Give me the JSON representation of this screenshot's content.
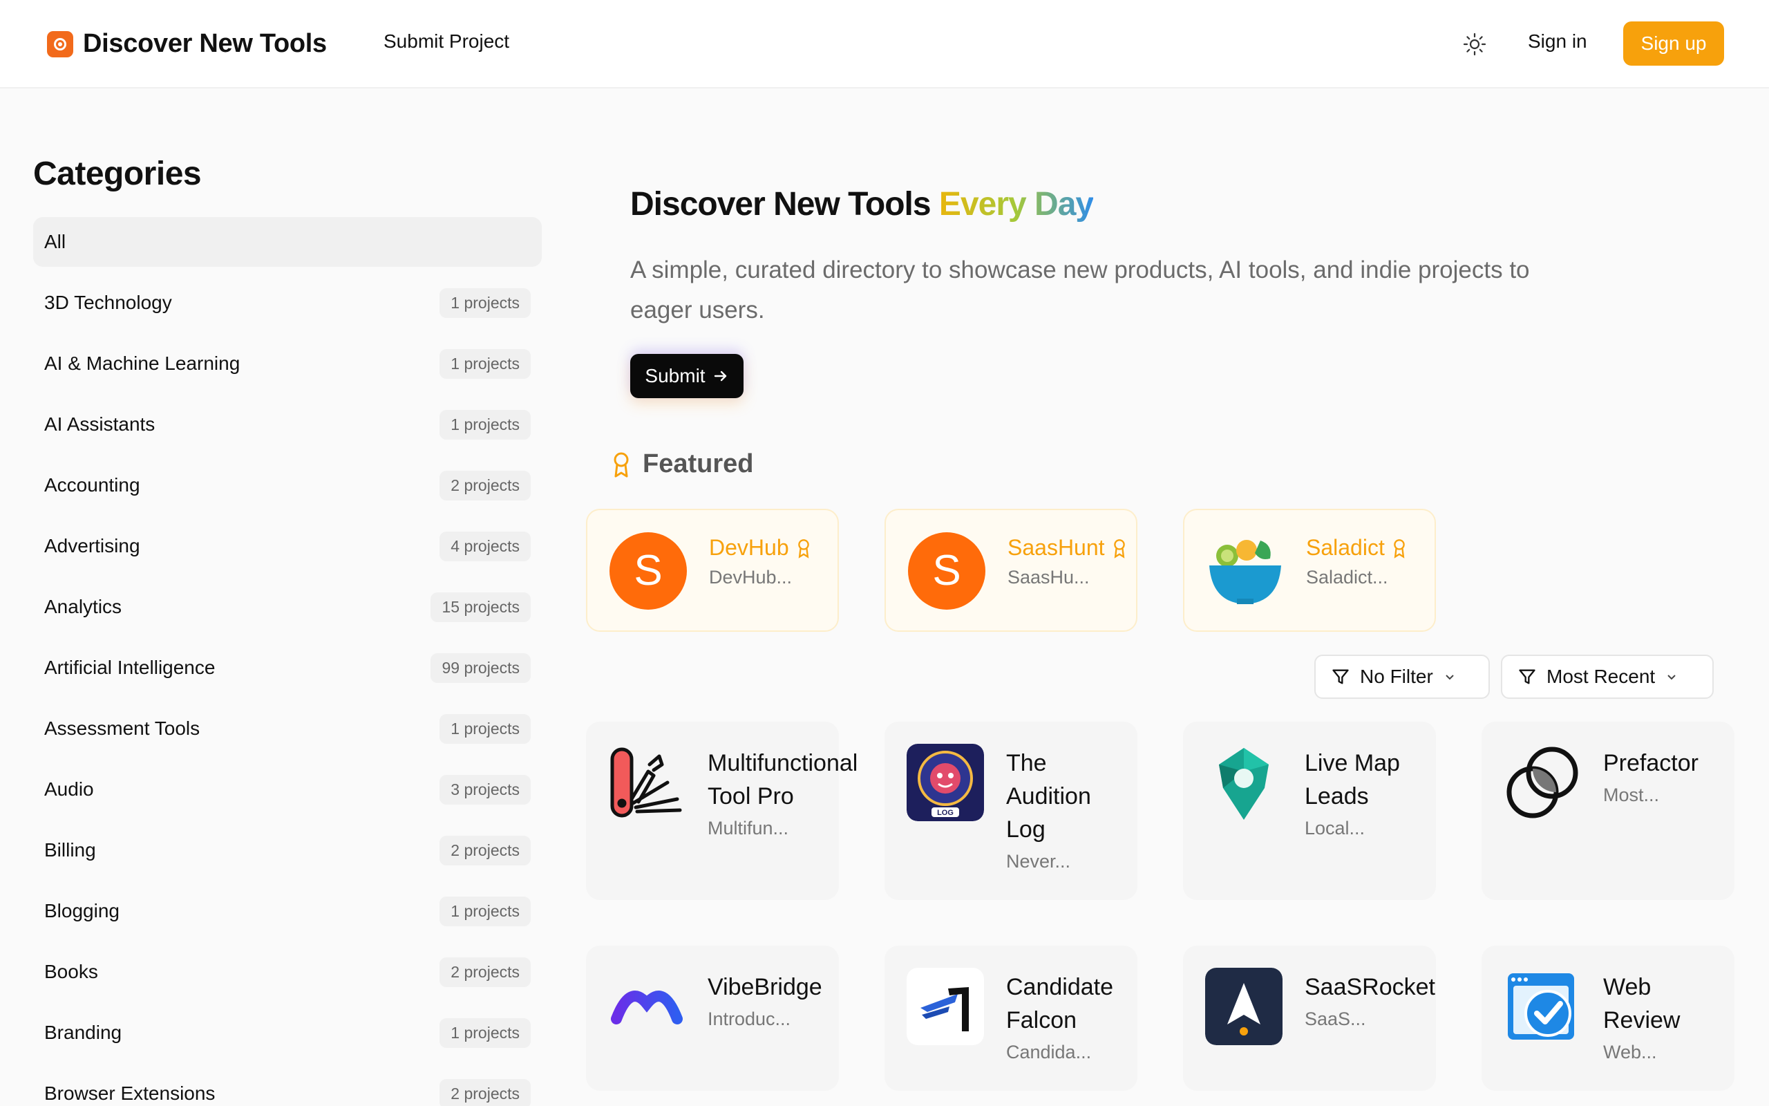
{
  "header": {
    "brand": "Discover New Tools",
    "nav_submit": "Submit Project",
    "sign_in": "Sign in",
    "sign_up": "Sign up"
  },
  "sidebar": {
    "title": "Categories",
    "items": [
      {
        "label": "All",
        "count": ""
      },
      {
        "label": "3D Technology",
        "count": "1 projects"
      },
      {
        "label": "AI & Machine Learning",
        "count": "1 projects"
      },
      {
        "label": "AI Assistants",
        "count": "1 projects"
      },
      {
        "label": "Accounting",
        "count": "2 projects"
      },
      {
        "label": "Advertising",
        "count": "4 projects"
      },
      {
        "label": "Analytics",
        "count": "15 projects"
      },
      {
        "label": "Artificial Intelligence",
        "count": "99 projects"
      },
      {
        "label": "Assessment Tools",
        "count": "1 projects"
      },
      {
        "label": "Audio",
        "count": "3 projects"
      },
      {
        "label": "Billing",
        "count": "2 projects"
      },
      {
        "label": "Blogging",
        "count": "1 projects"
      },
      {
        "label": "Books",
        "count": "2 projects"
      },
      {
        "label": "Branding",
        "count": "1 projects"
      },
      {
        "label": "Browser Extensions",
        "count": "2 projects"
      }
    ]
  },
  "hero": {
    "title_main": "Discover New Tools",
    "title_accent": "Every Day",
    "subtitle": "A simple, curated directory to showcase new products, AI tools, and indie projects to eager users.",
    "submit_label": "Submit"
  },
  "featured": {
    "label": "Featured",
    "items": [
      {
        "name": "DevHub",
        "desc": "DevHub...",
        "icon": "s-orange-logo"
      },
      {
        "name": "SaasHunt",
        "desc": "SaasHu...",
        "icon": "s-orange-logo"
      },
      {
        "name": "Saladict",
        "desc": "Saladict...",
        "icon": "salad-bowl-logo"
      }
    ]
  },
  "filters": {
    "filter_label": "No Filter",
    "sort_label": "Most Recent"
  },
  "projects": [
    {
      "name": "Multifunctional Tool Pro",
      "desc": "Multifun...",
      "icon": "multitool-logo"
    },
    {
      "name": "The Audition Log",
      "desc": "Never...",
      "icon": "audition-log-logo"
    },
    {
      "name": "Live Map Leads",
      "desc": "Local...",
      "icon": "map-pin-logo"
    },
    {
      "name": "Prefactor",
      "desc": "Most...",
      "icon": "overlapping-circles-logo"
    },
    {
      "name": "VibeBridge",
      "desc": "Introduc...",
      "icon": "arc-logo"
    },
    {
      "name": "Candidate Falcon",
      "desc": "Candida...",
      "icon": "falcon-logo"
    },
    {
      "name": "SaaSRocket",
      "desc": "SaaS...",
      "icon": "rocket-logo"
    },
    {
      "name": "Web Review",
      "desc": "Web...",
      "icon": "browser-check-logo"
    }
  ],
  "colors": {
    "accent": "#f7a10c",
    "brand_icon": "#f26a1b",
    "featured_bg": "#fffbf2"
  }
}
